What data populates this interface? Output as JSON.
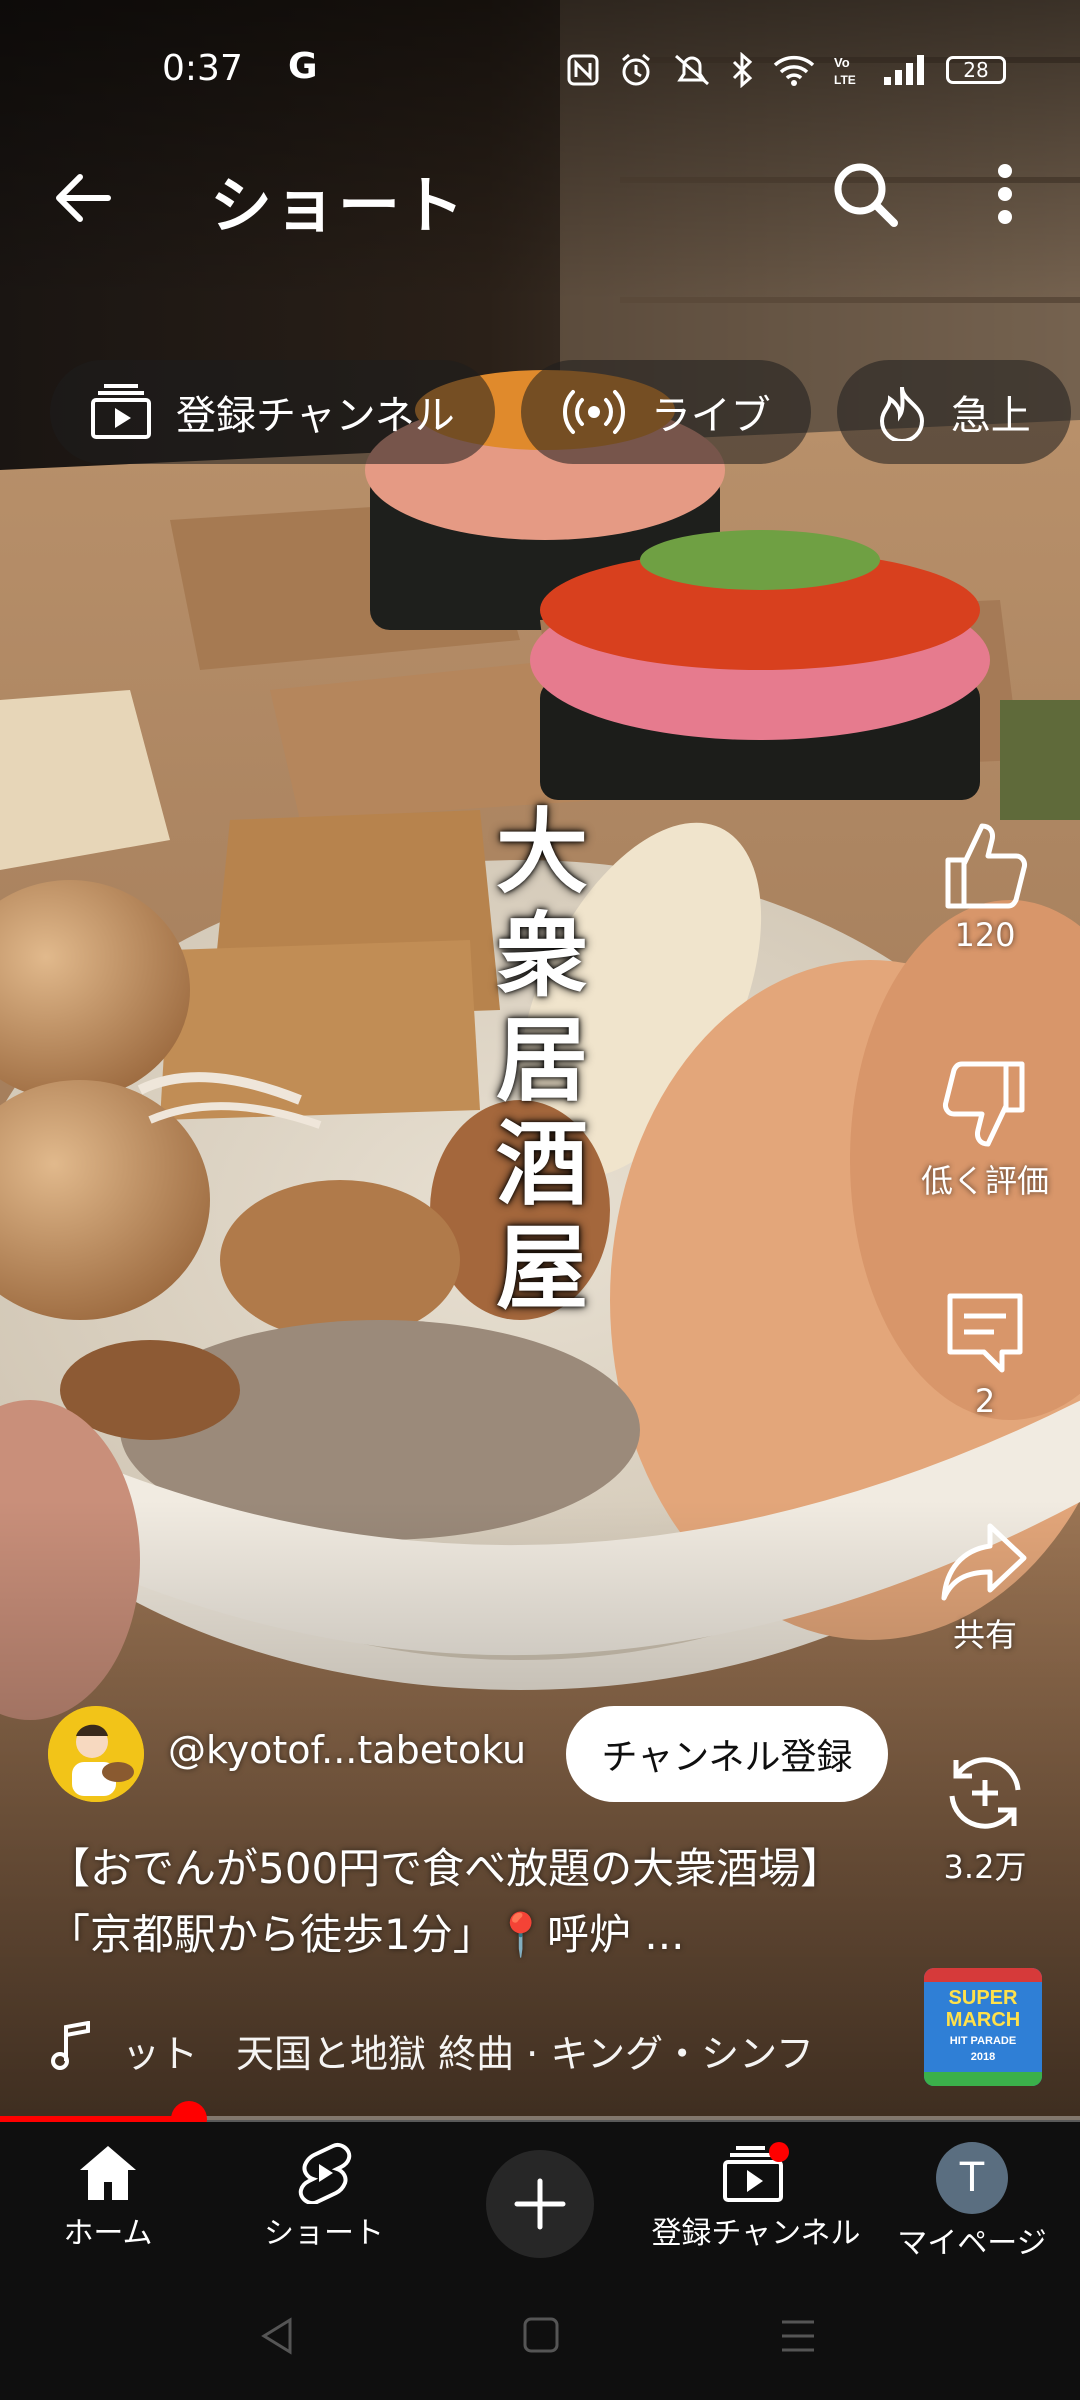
{
  "status_bar": {
    "time": "0:37",
    "carrier_glyph": "G",
    "battery": "28",
    "icons": [
      "nfc-icon",
      "alarm-icon",
      "mute-icon",
      "bluetooth-icon",
      "wifi-icon",
      "volte-icon",
      "signal-icon",
      "battery-icon"
    ]
  },
  "app_bar": {
    "title": "ショート",
    "back_icon": "back-arrow-icon",
    "search_icon": "search-icon",
    "more_icon": "more-vert-icon"
  },
  "chips": [
    {
      "label": "登録チャンネル",
      "icon": "subscriptions-icon"
    },
    {
      "label": "ライブ",
      "icon": "live-icon"
    },
    {
      "label": "急上",
      "icon": "trending-icon"
    }
  ],
  "video": {
    "overlay_text": [
      "大",
      "衆",
      "居",
      "酒",
      "屋"
    ]
  },
  "actions": {
    "like_count": "120",
    "dislike_label": "低く評価",
    "comment_count": "2",
    "share_label": "共有",
    "remix_count": "3.2万"
  },
  "channel": {
    "handle": "@kyotof...tabetoku",
    "subscribe_label": "チャンネル登録"
  },
  "description": "【おでんが500円で食べ放題の大衆酒場】「京都駅から徒歩1分」📍呼炉 ...",
  "music": {
    "text": "ット　天国と地獄 終曲 · キング・シンフ",
    "thumbnail_text": [
      "SUPER",
      "MARCH",
      "HIT PARADE",
      "2018"
    ]
  },
  "progress": {
    "fraction": 0.175
  },
  "bottom_nav": [
    {
      "label": "ホーム",
      "icon": "home-icon"
    },
    {
      "label": "ショート",
      "icon": "shorts-icon"
    },
    {
      "label": "",
      "icon": "create-plus-icon"
    },
    {
      "label": "登録チャンネル",
      "icon": "subscriptions-icon"
    },
    {
      "label": "マイページ",
      "icon": "avatar-icon",
      "avatar_letter": "T"
    }
  ],
  "colors": {
    "accent": "#ff0000",
    "nav_bg": "#0f0f0f",
    "subscribe_bg": "#ffffff"
  }
}
